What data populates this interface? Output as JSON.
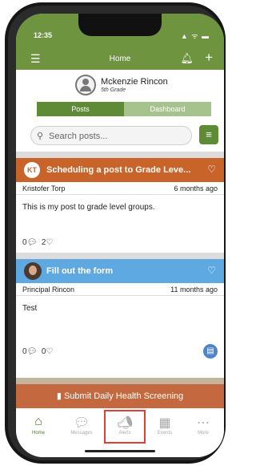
{
  "status": {
    "time": "12:35",
    "icons": "▲ ᯤ ▬"
  },
  "header": {
    "title": "Home"
  },
  "profile": {
    "name": "Mckenzie Rincon",
    "grade": "5th Grade"
  },
  "tabs": {
    "posts": "Posts",
    "dashboard": "Dashboard"
  },
  "search": {
    "placeholder": "Search posts..."
  },
  "posts": [
    {
      "badge": "KT",
      "title": "Scheduling a post to Grade Leve...",
      "author": "Kristofer Torp",
      "time": "6 months ago",
      "body": "This is my post to grade level groups.",
      "comments": "0",
      "likes": "2",
      "color": "#c8642a"
    },
    {
      "title": "Fill out the form",
      "author": "Principal Rincon",
      "time": "11 months ago",
      "body": "Test",
      "comments": "0",
      "likes": "0",
      "color": "#5ea9e2"
    }
  ],
  "health_button": "Submit Daily Health Screening",
  "tabbar": {
    "home": "Home",
    "messages": "Messages",
    "alerts": "Alerts",
    "events": "Events",
    "more": "More"
  },
  "colors": {
    "brand": "#6f9440",
    "highlight": "#d9403a"
  }
}
